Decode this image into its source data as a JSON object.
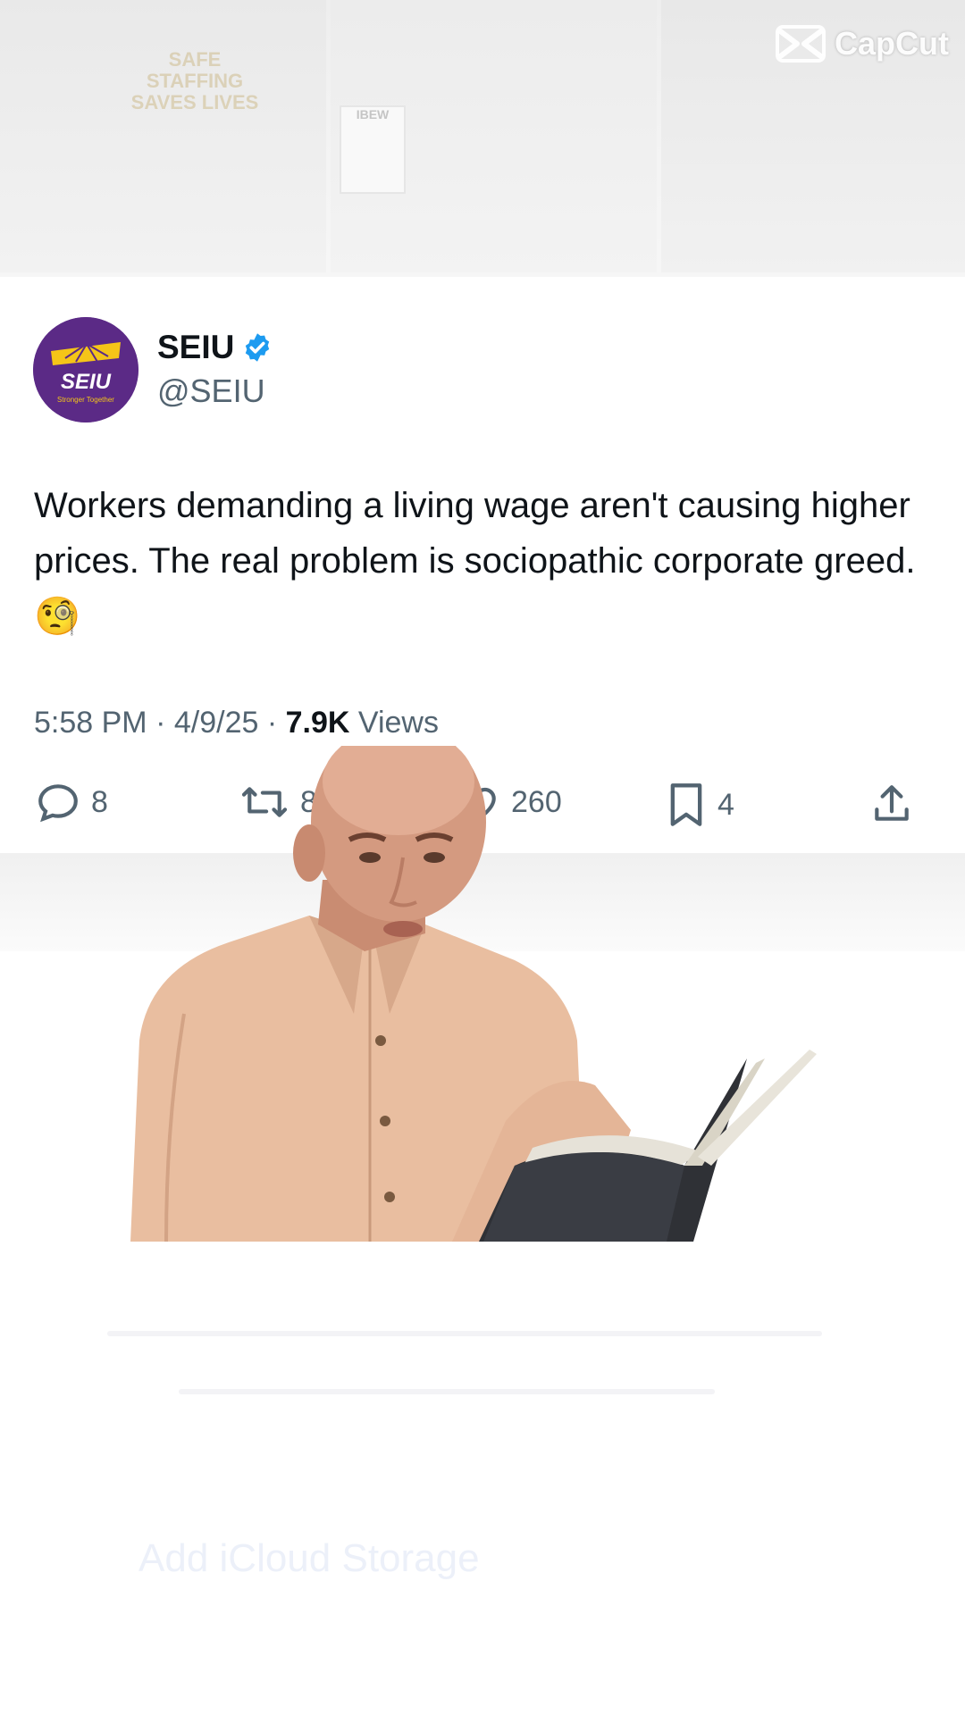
{
  "watermark": {
    "text": "CapCut",
    "icon": "capcut-logo-icon"
  },
  "background": {
    "signs": [
      "SAFE",
      "STAFFING",
      "SAVES",
      "LIVES",
      "IBEW"
    ]
  },
  "tweet": {
    "display_name": "SEIU",
    "handle": "@SEIU",
    "verified": true,
    "avatar_text": "SEIU",
    "avatar_subtext": "Stronger Together",
    "text": "Workers demanding a living wage aren't causing higher prices. The real problem is sociopathic corporate greed.",
    "emoji": "🧐",
    "time": "5:58 PM",
    "date": "4/9/25",
    "views_count": "7.9K",
    "views_label": "Views",
    "actions": {
      "replies": "8",
      "reposts": "8",
      "likes": "260",
      "bookmarks": "4"
    },
    "colors": {
      "verified": "#1d9bf0",
      "avatar_bg": "#5b2a86",
      "avatar_accent": "#f5c518"
    }
  },
  "overlay": {
    "description_icon": "man-reading-book-image"
  },
  "ghost_text": "Add iCloud Storage"
}
